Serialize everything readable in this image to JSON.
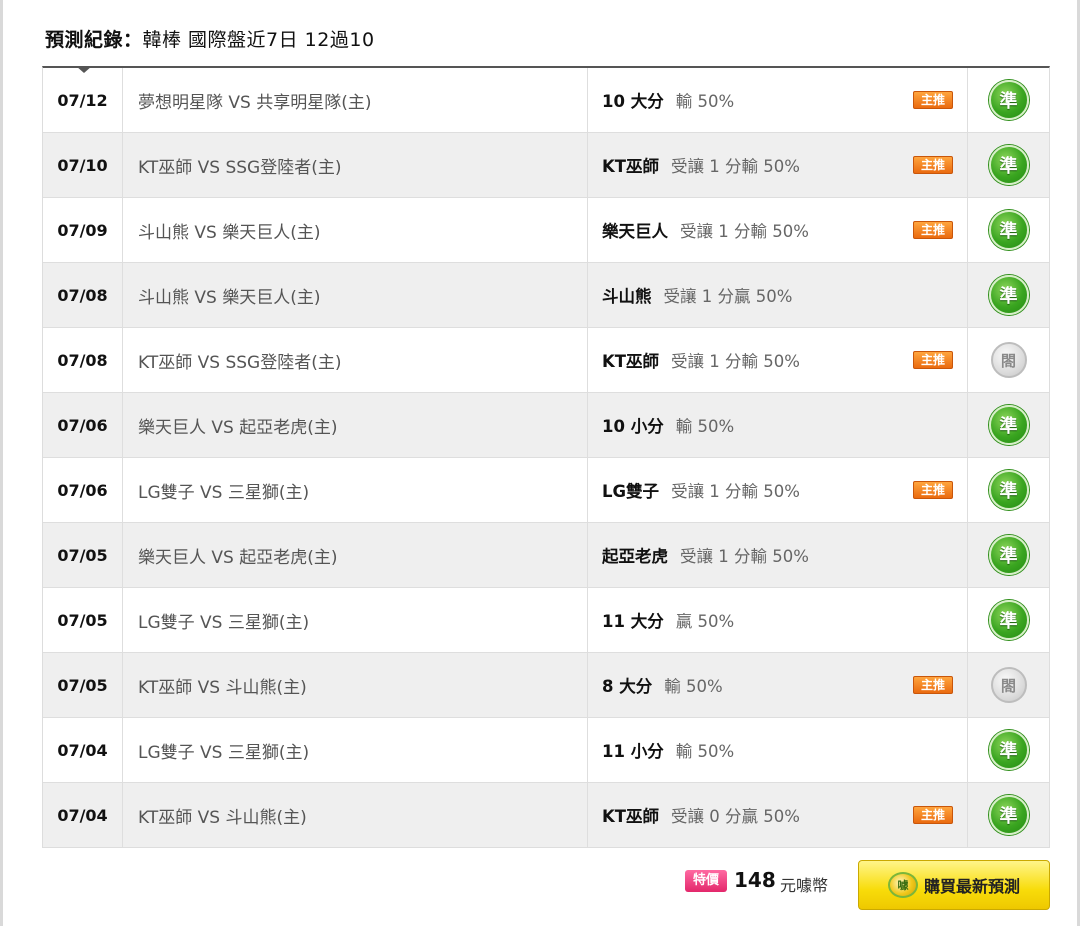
{
  "header": {
    "title": "預測紀錄：",
    "subtitle": "韓棒 國際盤近7日 12過10"
  },
  "rows": [
    {
      "date": "07/12",
      "match": "夢想明星隊 VS 共享明星隊(主)",
      "pick": "10 大分",
      "detail": "輸 50%",
      "main_pick": true,
      "result": "準"
    },
    {
      "date": "07/10",
      "match": "KT巫師 VS SSG登陸者(主)",
      "pick": "KT巫師",
      "detail": "受讓 1 分輸 50%",
      "main_pick": true,
      "result": "準"
    },
    {
      "date": "07/09",
      "match": "斗山熊 VS 樂天巨人(主)",
      "pick": "樂天巨人",
      "detail": "受讓 1 分輸 50%",
      "main_pick": true,
      "result": "準"
    },
    {
      "date": "07/08",
      "match": "斗山熊 VS 樂天巨人(主)",
      "pick": "斗山熊",
      "detail": "受讓 1 分贏 50%",
      "main_pick": false,
      "result": "準"
    },
    {
      "date": "07/08",
      "match": "KT巫師 VS SSG登陸者(主)",
      "pick": "KT巫師",
      "detail": "受讓 1 分輸 50%",
      "main_pick": true,
      "result": "閤"
    },
    {
      "date": "07/06",
      "match": "樂天巨人 VS 起亞老虎(主)",
      "pick": "10 小分",
      "detail": "輸 50%",
      "main_pick": false,
      "result": "準"
    },
    {
      "date": "07/06",
      "match": "LG雙子 VS 三星獅(主)",
      "pick": "LG雙子",
      "detail": "受讓 1 分輸 50%",
      "main_pick": true,
      "result": "準"
    },
    {
      "date": "07/05",
      "match": "樂天巨人 VS 起亞老虎(主)",
      "pick": "起亞老虎",
      "detail": "受讓 1 分輸 50%",
      "main_pick": false,
      "result": "準"
    },
    {
      "date": "07/05",
      "match": "LG雙子 VS 三星獅(主)",
      "pick": "11 大分",
      "detail": "贏 50%",
      "main_pick": false,
      "result": "準"
    },
    {
      "date": "07/05",
      "match": "KT巫師 VS 斗山熊(主)",
      "pick": "8 大分",
      "detail": "輸 50%",
      "main_pick": true,
      "result": "閤"
    },
    {
      "date": "07/04",
      "match": "LG雙子 VS 三星獅(主)",
      "pick": "11 小分",
      "detail": "輸 50%",
      "main_pick": false,
      "result": "準"
    },
    {
      "date": "07/04",
      "match": "KT巫師 VS 斗山熊(主)",
      "pick": "KT巫師",
      "detail": "受讓 0 分贏 50%",
      "main_pick": true,
      "result": "準"
    }
  ],
  "labels": {
    "main_pick_badge": "主推",
    "result_win": "準",
    "result_draw": "閤"
  },
  "footer": {
    "special_badge": "特價",
    "price": "148",
    "unit": "元噱幣",
    "coin_icon_text": "噱",
    "buy_label": "購買最新預測"
  },
  "colors": {
    "win_green": "#3aa520",
    "main_pick_orange": "#ea6a0f",
    "special_pink": "#e3276b",
    "buy_yellow": "#f8dc0a"
  }
}
